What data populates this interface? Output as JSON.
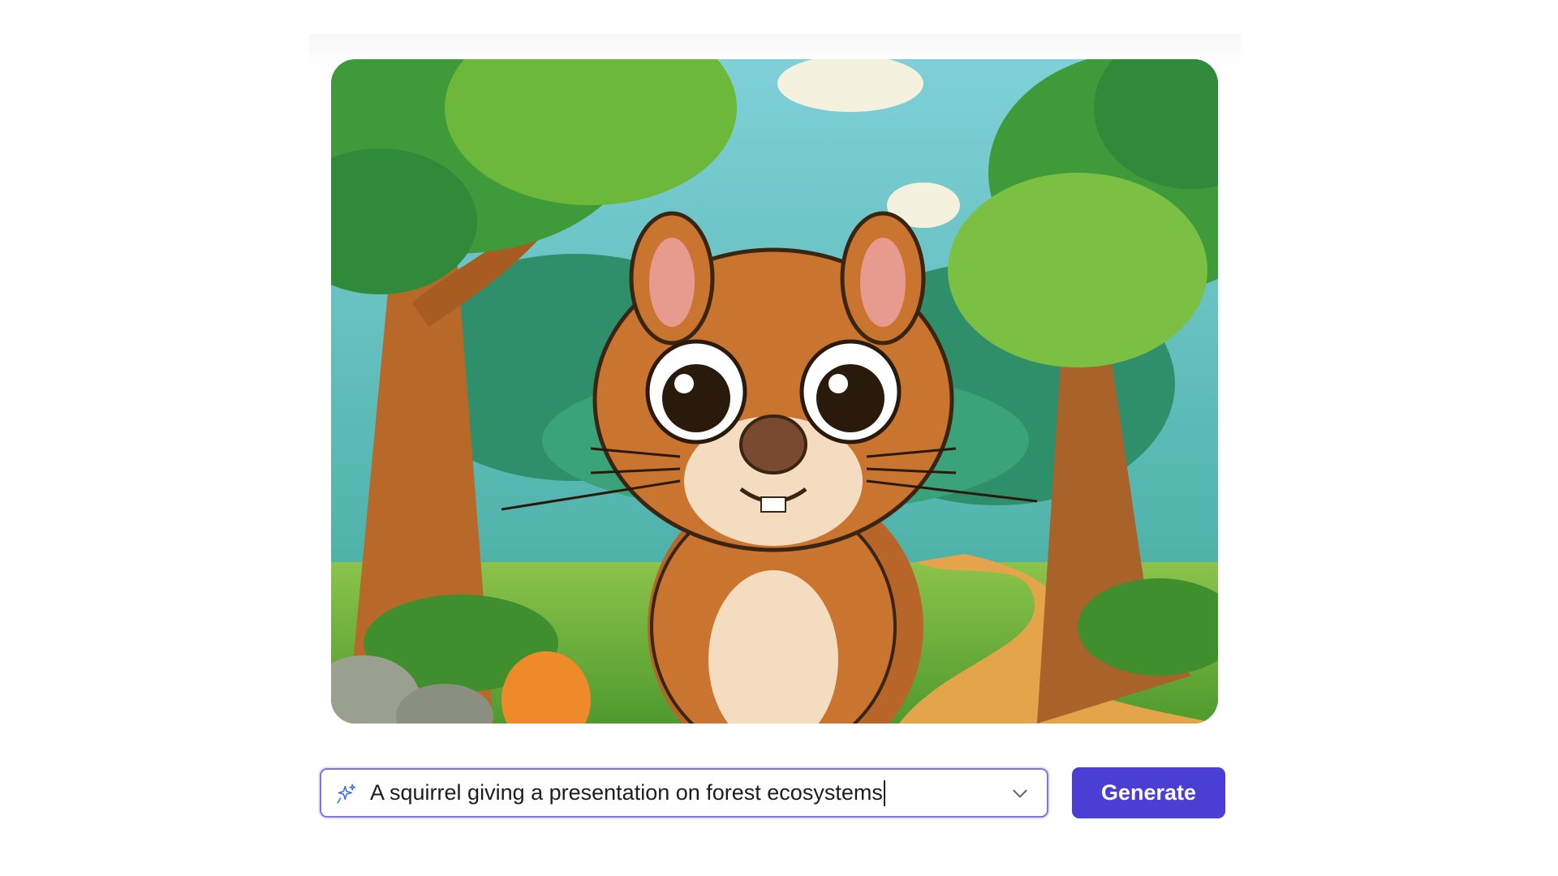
{
  "generated_image": {
    "icon": "squirrel-forest-illustration"
  },
  "prompt": {
    "value": "A squirrel giving a presentation on forest ecosystems",
    "leading_icon": "sparkle-icon",
    "trailing_icon": "chevron-down-icon"
  },
  "actions": {
    "generate_label": "Generate"
  },
  "colors": {
    "accent": "#4a3ed4",
    "focus_border": "#7b74e6"
  }
}
